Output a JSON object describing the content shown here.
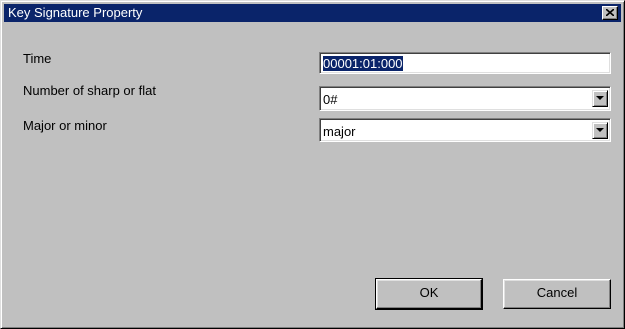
{
  "window": {
    "title": "Key Signature Property"
  },
  "form": {
    "time": {
      "label": "Time",
      "value": "00001:01:000"
    },
    "sharp_flat": {
      "label": "Number of sharp or flat",
      "value": "0#"
    },
    "major_minor": {
      "label": "Major or minor",
      "value": "major"
    }
  },
  "buttons": {
    "ok": "OK",
    "cancel": "Cancel"
  },
  "icons": {
    "close": "close-icon",
    "dropdown": "chevron-down-icon"
  },
  "colors": {
    "titlebar": "#0a246a",
    "face": "#c0c0c0",
    "selection": "#0a246a"
  }
}
